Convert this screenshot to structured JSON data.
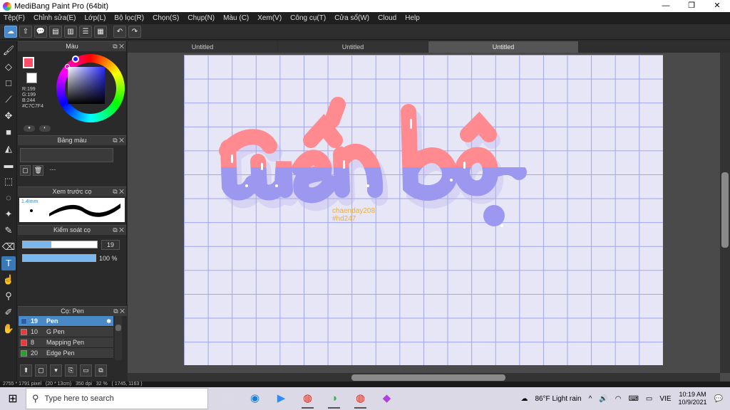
{
  "window": {
    "title": "MediBang Paint Pro (64bit)",
    "minimize": "—",
    "maximize": "❐",
    "close": "✕"
  },
  "menu": [
    "Tệp(F)",
    "Chỉnh sửa(E)",
    "Lớp(L)",
    "Bộ lọc(R)",
    "Chọn(S)",
    "Chụp(N)",
    "Màu (C)",
    "Xem(V)",
    "Công cụ(T)",
    "Cửa sổ(W)",
    "Cloud",
    "Help"
  ],
  "toolbar": {
    "undo_icon": "↶",
    "redo_icon": "↷"
  },
  "panels": {
    "color": {
      "title": "Màu",
      "r": "R:199",
      "g": "G:199",
      "b": "B:244",
      "hex": "#C7C7F4",
      "fg_color": "#ff4f6a",
      "bg_color": "#ffffff"
    },
    "palette": {
      "title": "Bảng màu",
      "dash": "---"
    },
    "preview": {
      "title": "Xem trước cọ",
      "size": "1.4Imm"
    },
    "control": {
      "title": "Kiểm soát cọ",
      "size_value": "19",
      "opacity_value": "100 %",
      "size_fraction": 0.38,
      "opacity_fraction": 1.0
    },
    "brush": {
      "title": "Cọ: Pen",
      "items": [
        {
          "size": "19",
          "name": "Pen",
          "color": "#2b5fa8",
          "selected": true
        },
        {
          "size": "10",
          "name": "G Pen",
          "color": "#e83c3c",
          "selected": false
        },
        {
          "size": "8",
          "name": "Mapping Pen",
          "color": "#e83c3c",
          "selected": false
        },
        {
          "size": "20",
          "name": "Edge Pen",
          "color": "#2aa02a",
          "selected": false
        }
      ]
    }
  },
  "tabs": [
    "Untitled",
    "Untitled",
    "Untitled"
  ],
  "canvas": {
    "lettering": "tiến bộ",
    "caption_line1": "chaenday208",
    "caption_line2": "#hd247",
    "pink": "#ff8a8f",
    "purple": "#9c98f0",
    "grid": "#9ea4ee",
    "paper": "#e6e6f7"
  },
  "status": "2755 * 1791 pixel   (20 * 13cm)   350 dpi   32 %   ( 1745, 1163 )",
  "taskbar": {
    "search_placeholder": "Type here to search",
    "weather": "86°F  Light rain",
    "lang": "VIE",
    "time": "10:19 AM",
    "date": "10/9/2021"
  }
}
